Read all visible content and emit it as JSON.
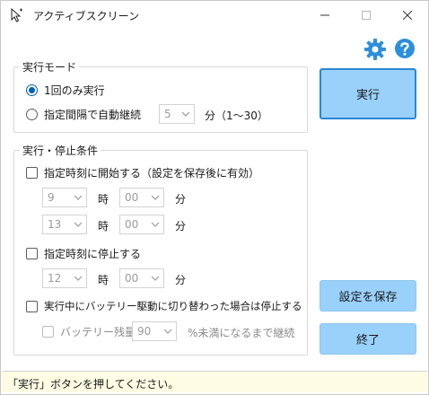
{
  "window": {
    "title": "アクティブスクリーン",
    "controls": [
      "minimize",
      "maximize",
      "close"
    ]
  },
  "toolbar": {
    "icons": [
      "gear-icon",
      "help-icon"
    ]
  },
  "mode_group": {
    "legend": "実行モード",
    "radio_once_label": "1回のみ実行",
    "radio_once_checked": true,
    "radio_interval_label": "指定間隔で自動継続",
    "radio_interval_checked": false,
    "interval_value": "5",
    "interval_unit": "分（1〜30）"
  },
  "condition_group": {
    "legend": "実行・停止条件",
    "start_checkbox_label": "指定時刻に開始する（設定を保存後に有効）",
    "start_checked": false,
    "start_time_1": {
      "hour": "9",
      "minute": "00"
    },
    "start_time_2": {
      "hour": "13",
      "minute": "00"
    },
    "stop_checkbox_label": "指定時刻に停止する",
    "stop_checked": false,
    "stop_time": {
      "hour": "12",
      "minute": "00"
    },
    "hour_unit": "時",
    "minute_unit": "分",
    "battery_checkbox_label": "実行中にバッテリー駆動に切り替わった場合は停止する",
    "battery_checked": false,
    "battery_remaining_label": "バッテリー残量が",
    "battery_remaining_value": "90",
    "battery_remaining_suffix": "%未満になるまで継続"
  },
  "buttons": {
    "run": "実行",
    "save": "設定を保存",
    "exit": "終了"
  },
  "status": {
    "message": "「実行」ボタンを押してください。"
  },
  "colors": {
    "button_fill": "#99d1fb",
    "button_focus_border": "#2a86d6",
    "icon_blue": "#2c8fdc",
    "status_background": "#fffce4",
    "radio_accent": "#005fb8"
  }
}
